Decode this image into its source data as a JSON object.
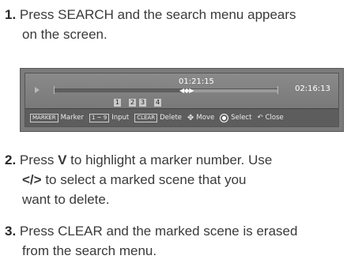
{
  "steps": [
    {
      "num": "1.",
      "line1": "Press SEARCH and the search menu appears",
      "line2": "on the screen."
    },
    {
      "num": "2.",
      "line1a": "Press ",
      "line1b": "V",
      "line1c": " to highlight a marker number. Use",
      "line2a": "</>",
      "line2b": " to select a marked scene that you",
      "line3": "want to delete."
    },
    {
      "num": "3.",
      "line1": "Press CLEAR and the marked scene is erased",
      "line2": "from the search menu."
    }
  ],
  "screen": {
    "current_time": "01:21:15",
    "total_time": "02:16:13",
    "progress": 0.57,
    "markers": [
      "1",
      "2",
      "3",
      "4"
    ],
    "bottom": {
      "marker_key": "MARKER",
      "marker_label": "Marker",
      "input_key": "1 ~ 9",
      "input_label": "Input",
      "clear_key": "CLEAR",
      "clear_label": "Delete",
      "move_label": "Move",
      "select_label": "Select",
      "close_label": "Close"
    }
  }
}
